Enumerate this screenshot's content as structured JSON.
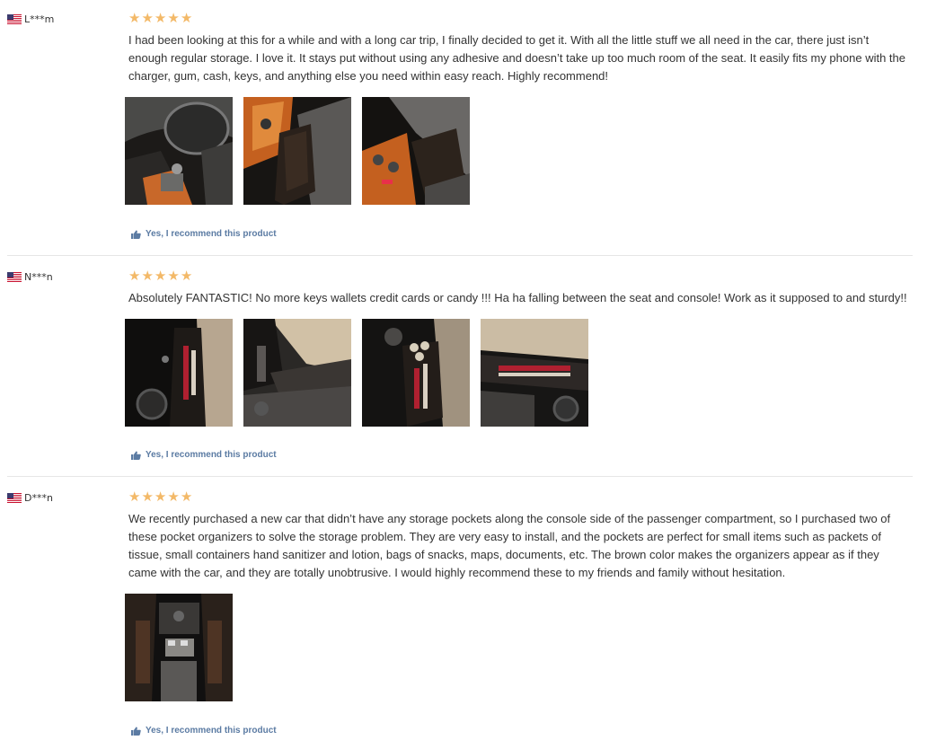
{
  "reviews": [
    {
      "user": "L***m",
      "country_icon": "us-flag-icon",
      "rating": 5,
      "text": "I had been looking at this for a while and with a long car trip, I finally decided to get it. With all the little stuff we all need in the car, there just isn’t enough regular storage. I love it. It stays put without using any adhesive and doesn’t take up too much room of the seat. It easily fits my phone with the charger, gum, cash, keys, and anything else you need within easy reach. Highly recommend!",
      "photo_count": 3,
      "recommend_label": "Yes, I recommend this product"
    },
    {
      "user": "N***n",
      "country_icon": "us-flag-icon",
      "rating": 5,
      "text": "Absolutely FANTASTIC! No more keys wallets credit cards or candy !!! Ha ha falling between the seat and console! Work as it supposed to and sturdy!!",
      "photo_count": 4,
      "recommend_label": "Yes, I recommend this product"
    },
    {
      "user": "D***n",
      "country_icon": "us-flag-icon",
      "rating": 5,
      "text": "We recently purchased a new car that didn’t have any storage pockets along the console side of the passenger compartment, so I purchased two of these pocket organizers to solve the storage problem. They are very easy to install, and the pockets are perfect for small items such as packets of tissue, small containers hand sanitizer and lotion, bags of snacks, maps, documents, etc. The brown color makes the organizers appear as if they came with the car, and they are totally unobtrusive. I would highly recommend these to my friends and family without hesitation.",
      "photo_count": 1,
      "recommend_label": "Yes, I recommend this product"
    }
  ],
  "colors": {
    "star": "#f3b968",
    "recommend_link": "#5b7ba3",
    "text": "#333333",
    "divider": "#e6e6e6"
  }
}
